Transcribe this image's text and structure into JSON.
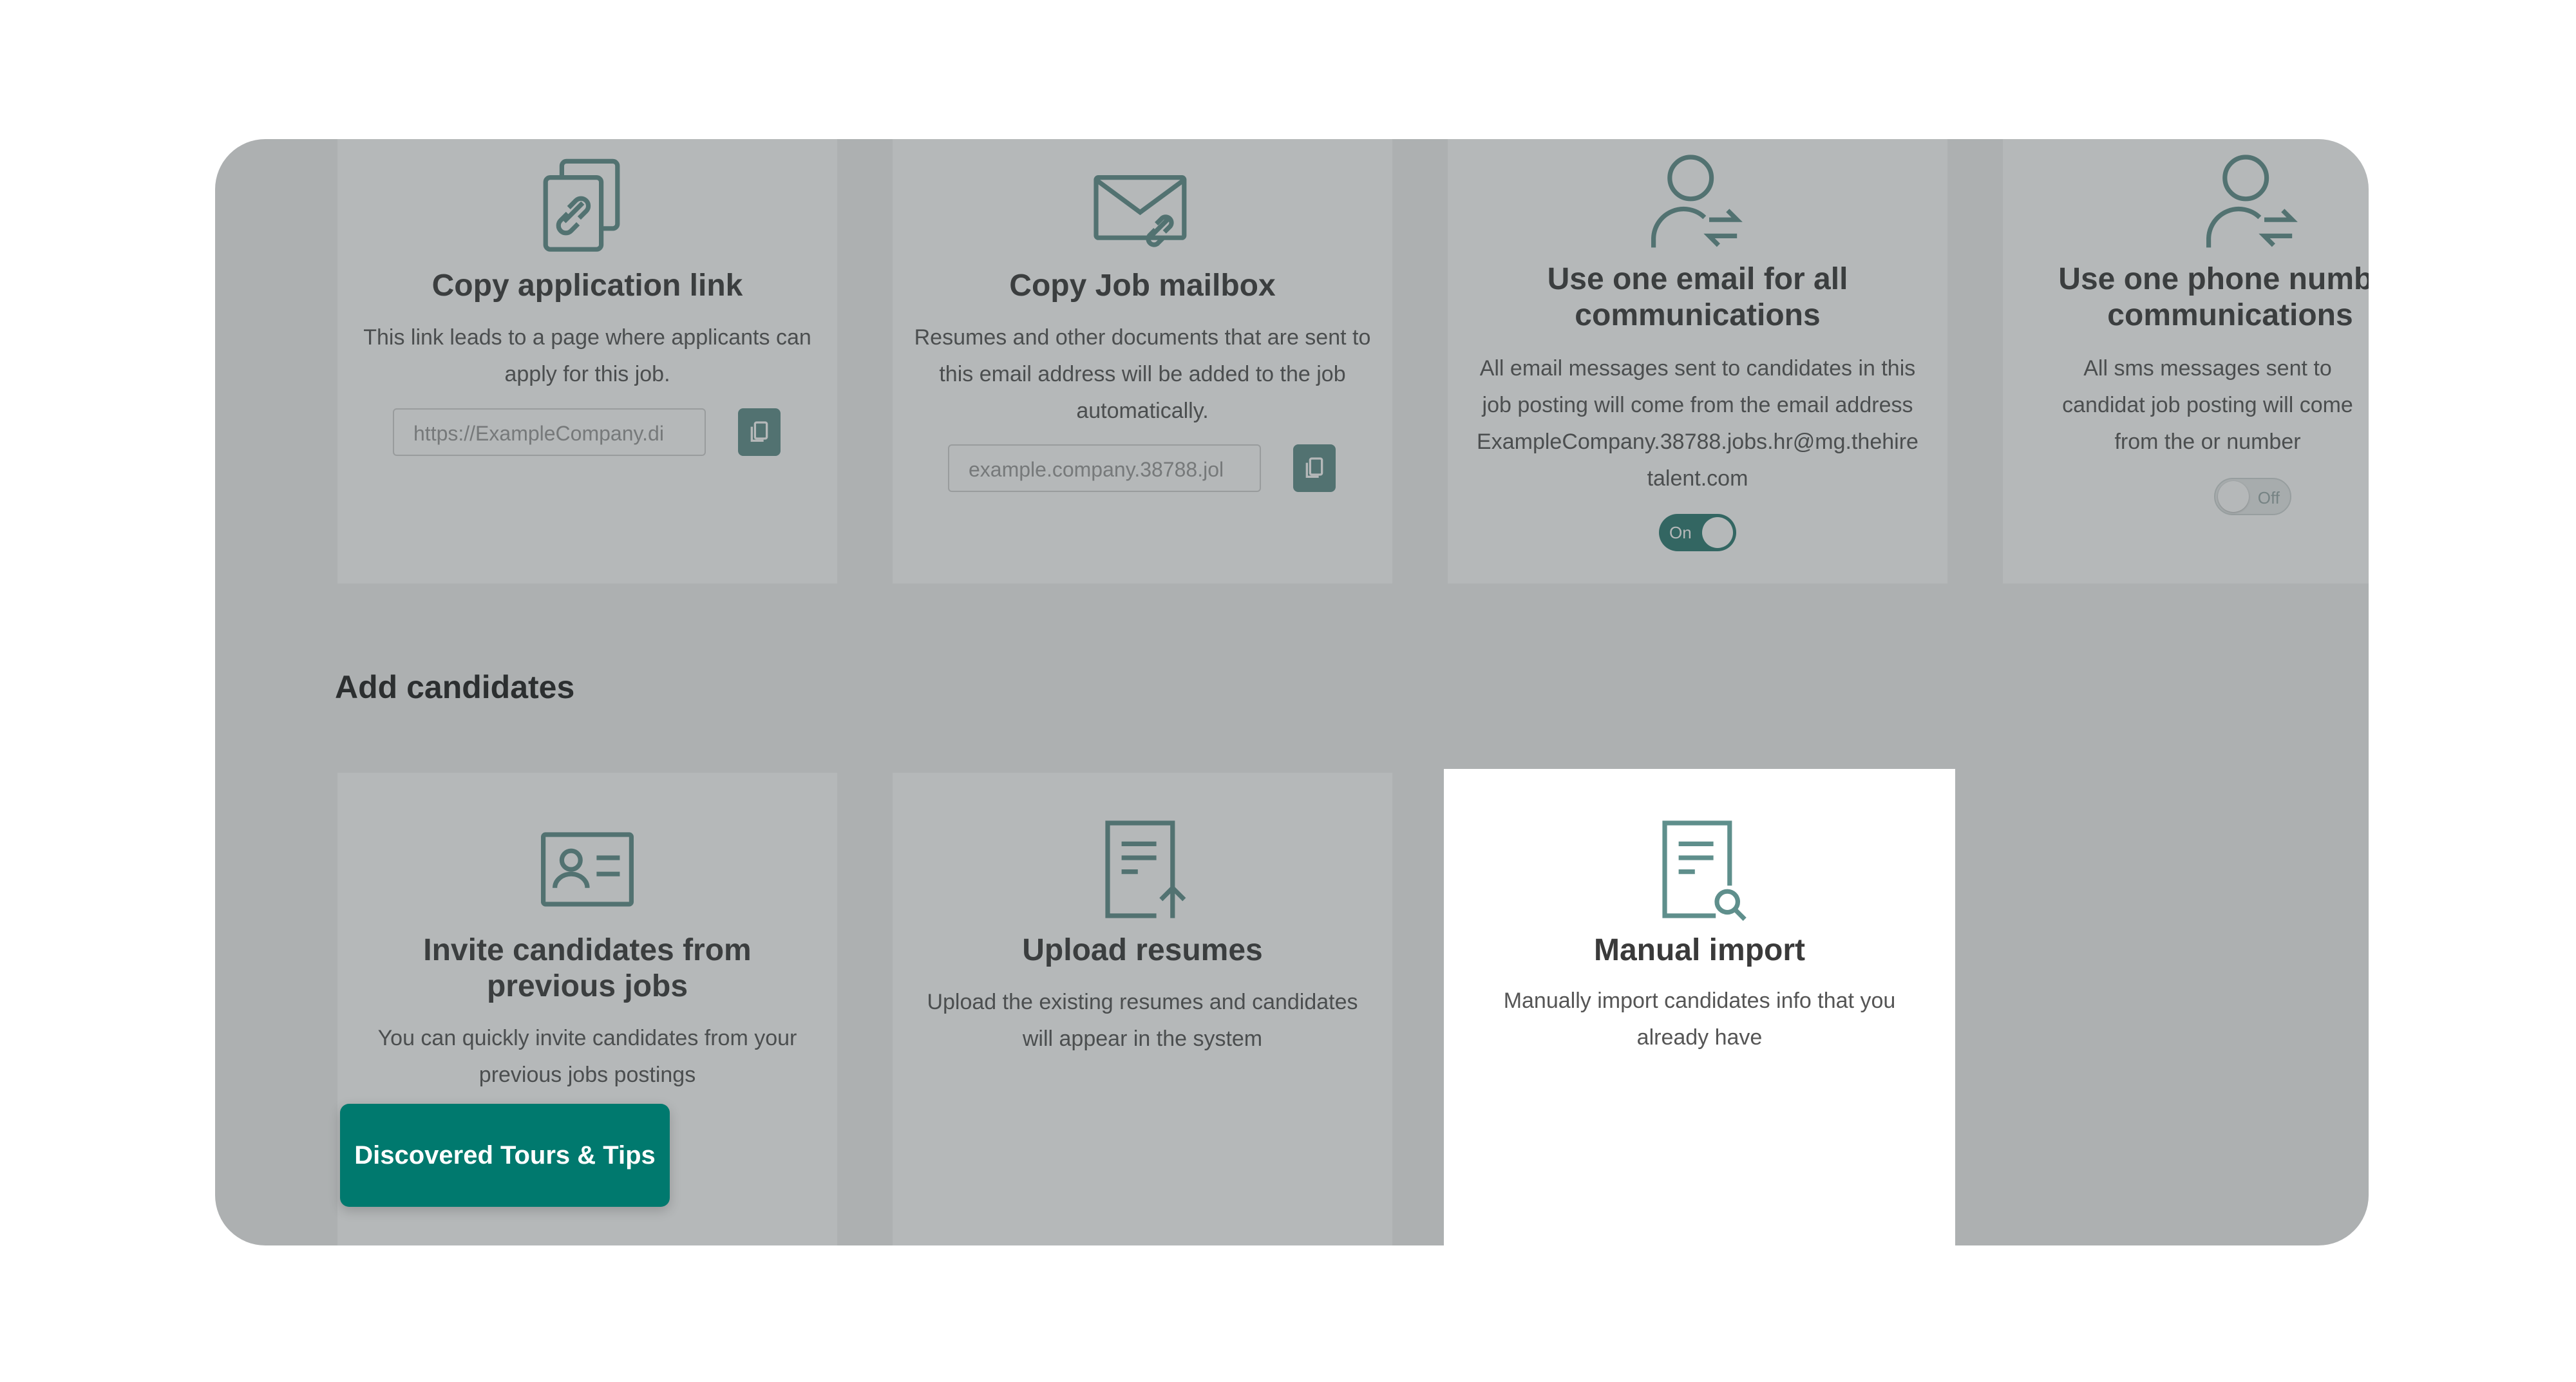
{
  "colors": {
    "accent": "#5f8f8c",
    "toggle_on": "#2e7b73",
    "tips_button": "#00796e",
    "overlay": "#3c4446"
  },
  "share_cards": [
    {
      "icon": "copy-link-icon",
      "title": "Copy application link",
      "description": "This link leads to a page where applicants can apply for this job.",
      "input_value": "https://ExampleCompany.di",
      "copy_button_icon": "copy-icon"
    },
    {
      "icon": "mailbox-link-icon",
      "title": "Copy Job mailbox",
      "description": "Resumes and other documents that are sent to this email address will be added to the job automatically.",
      "input_value": "example.company.38788.jol",
      "copy_button_icon": "copy-icon"
    },
    {
      "icon": "user-exchange-icon",
      "title": "Use one email for all communications",
      "description": "All email messages sent to candidates in this job posting will come from the email address ExampleCompany.38788.jobs.hr@mg.thehire talent.com",
      "toggle_label": "On",
      "toggle_state": "on"
    },
    {
      "icon": "user-exchange-icon",
      "title": "Use one phone number communications",
      "description": "All sms messages sent to candidat job posting will come from the or number",
      "toggle_label": "Off",
      "toggle_state": "off"
    }
  ],
  "section_title": "Add candidates",
  "candidate_cards": [
    {
      "icon": "contact-card-icon",
      "title": "Invite candidates from previous jobs",
      "description": "You can quickly invite candidates from your previous jobs postings"
    },
    {
      "icon": "upload-document-icon",
      "title": "Upload resumes",
      "description": "Upload the existing resumes and candidates will appear in the system"
    },
    {
      "icon": "document-search-icon",
      "title": "Manual import",
      "description": "Manually import candidates info that you already have"
    }
  ],
  "tips_button_label": "Discovered Tours & Tips"
}
